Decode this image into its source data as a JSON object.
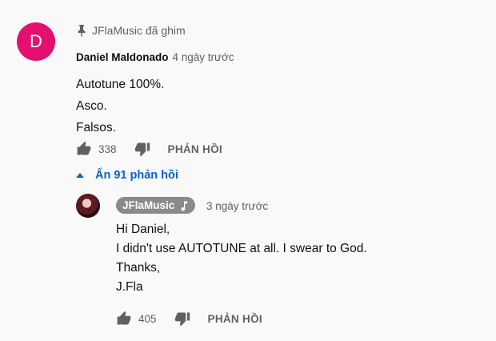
{
  "comment": {
    "avatar_letter": "D",
    "avatar_color": "#e4106e",
    "pinned_text": "JFlaMusic đã ghim",
    "author": "Daniel Maldonado",
    "time": "4 ngày trước",
    "lines": [
      "Autotune 100%.",
      "Asco.",
      "Falsos."
    ],
    "like_count": "338",
    "reply_label": "PHẢN HỒI"
  },
  "replies_toggle": {
    "label": "Ẩn 91 phản hồi",
    "color": "#065fd4"
  },
  "reply": {
    "author": "JFlaMusic",
    "time": "3 ngày trước",
    "lines": [
      "Hi Daniel,",
      "I didn't use AUTOTUNE at all. I swear to God.",
      "Thanks,",
      "J.Fla"
    ],
    "like_count": "405",
    "reply_label": "PHẢN HỒI"
  }
}
